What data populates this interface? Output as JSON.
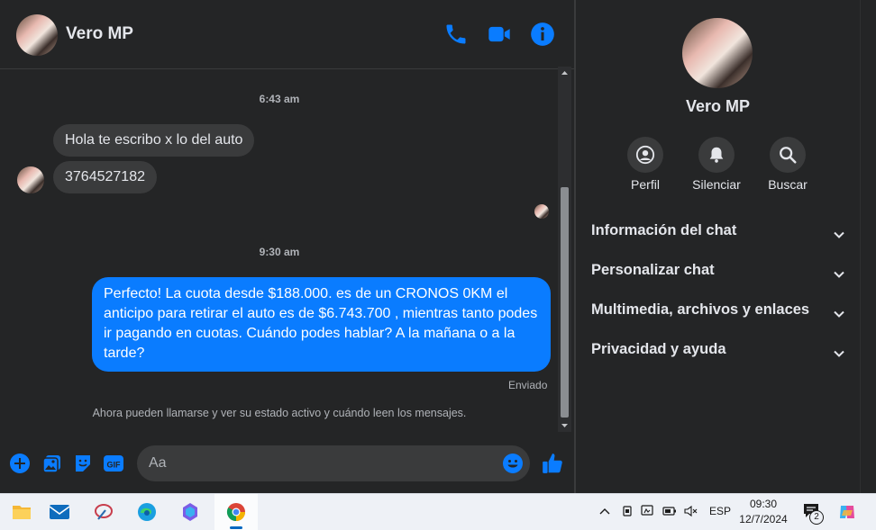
{
  "header": {
    "contact_name": "Vero MP",
    "icons": [
      "phone-icon",
      "video-camera-icon",
      "info-icon"
    ]
  },
  "conversation": {
    "timestamp_1": "6:43 am",
    "incoming_1": "Hola te escribo x lo del auto",
    "incoming_2": "3764527182",
    "timestamp_2": "9:30 am",
    "outgoing_1": "Perfecto! La cuota desde $188.000. es de un CRONOS 0KM el anticipo para retirar el auto es de $6.743.700 , mientras tanto podes ir pagando en cuotas. Cuándo podes hablar? A la mañana o a la tarde?",
    "sent_status": "Enviado",
    "system_note": "Ahora pueden llamarse y ver su estado activo y cuándo leen los mensajes."
  },
  "composer": {
    "placeholder": "Aa",
    "icons": [
      "plus-icon",
      "image-icon",
      "sticker-icon",
      "gif-icon",
      "emoji-icon",
      "thumbs-up-icon"
    ]
  },
  "info_panel": {
    "name": "Vero MP",
    "actions": [
      {
        "label": "Perfil",
        "icon": "profile-icon"
      },
      {
        "label": "Silenciar",
        "icon": "bell-icon"
      },
      {
        "label": "Buscar",
        "icon": "search-icon"
      }
    ],
    "sections": [
      {
        "label": "Información del chat"
      },
      {
        "label": "Personalizar chat"
      },
      {
        "label": "Multimedia, archivos y enlaces"
      },
      {
        "label": "Privacidad y ayuda"
      }
    ]
  },
  "taskbar": {
    "apps": [
      "file-explorer-icon",
      "mail-icon",
      "paint-icon",
      "edge-icon",
      "copilot-icon",
      "chrome-icon"
    ],
    "language": "ESP",
    "time": "09:30",
    "date": "12/7/2024",
    "notification_count": "2"
  },
  "colors": {
    "background": "#242526",
    "bubble_incoming": "#3a3b3c",
    "bubble_outgoing": "#0a7cff",
    "accent": "#0a7cff"
  }
}
